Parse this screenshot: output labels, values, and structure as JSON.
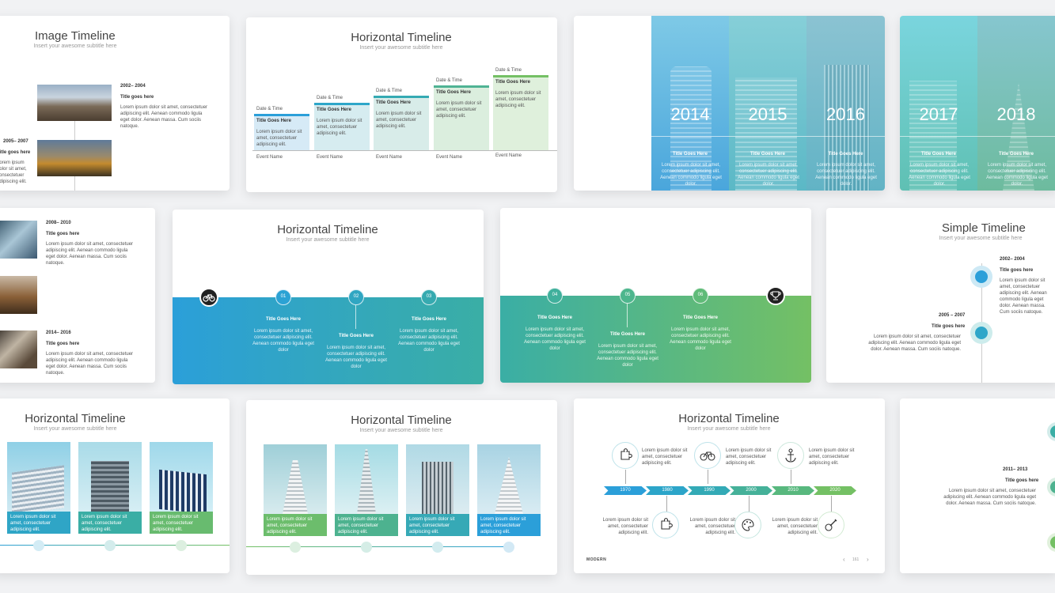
{
  "common": {
    "subtitle": "Insert your awesome subtitle here",
    "lorem_short": "Lorem ipsum dolor sit amet, consectetuer adipiscing elit.",
    "lorem_long": "Lorem ipsum dolor sit amet, consectetuer adipiscing elit. Aenean commodo ligula eget dolor. Aenean massa. Cum sociis natoque.",
    "lorem_mid": "Lorem ipsum dolor sit amet, consectetuer adipiscing elit. Aenean commodo ligula eget dolor",
    "lorem_two": "Lorem ipsum dolor sit amet, consectetuer adipiscing elit. Aenean commodo ligula eget dolor.",
    "title_goes_here": "Title goes here",
    "title_goes_here_caps": "Title Goes Here",
    "date_time": "Date & Time",
    "event_name": "Event Name",
    "lorem_tile": "Lorem ipsum dolor sit amet, consectetuer adipiscing elit.",
    "lorem_box": "Lorem ipsum dolor sit amet, consectetuer adipiscing elit."
  },
  "s1": {
    "title": "Image Timeline",
    "date1": "2002– 2004",
    "date2": "2005– 2007"
  },
  "s2": {
    "title": "Horizontal Timeline"
  },
  "s3": {
    "years": [
      "2014",
      "2015",
      "2016"
    ],
    "item_title": "Title Goes Here"
  },
  "s4": {
    "years": [
      "2017",
      "2018"
    ],
    "item_title": "Title Goes Here"
  },
  "s5": {
    "date1": "2008– 2010",
    "date2": "2014– 2016"
  },
  "s6": {
    "title": "Horizontal Timeline",
    "steps": [
      "01",
      "02",
      "03"
    ],
    "item_title": "Title Goes Here"
  },
  "s7": {
    "steps": [
      "04",
      "05",
      "06"
    ],
    "item_title": "Title Goes Here"
  },
  "s8": {
    "title": "Simple Timeline",
    "date1": "2002– 2004",
    "date2": "2005 – 2007"
  },
  "s9": {
    "title": "Horizontal Timeline"
  },
  "s10": {
    "title": "Horizontal Timeline"
  },
  "s11": {
    "title": "Horizontal Timeline",
    "years": [
      "1970",
      "1980",
      "1990",
      "2000",
      "2010",
      "2020"
    ],
    "footer_brand": "MODERN",
    "page_num": "161"
  },
  "s12": {
    "date": "2011– 2013"
  },
  "colors": {
    "blue": "#2b9fd9",
    "teal": "#3aaea5",
    "green": "#74c064"
  }
}
